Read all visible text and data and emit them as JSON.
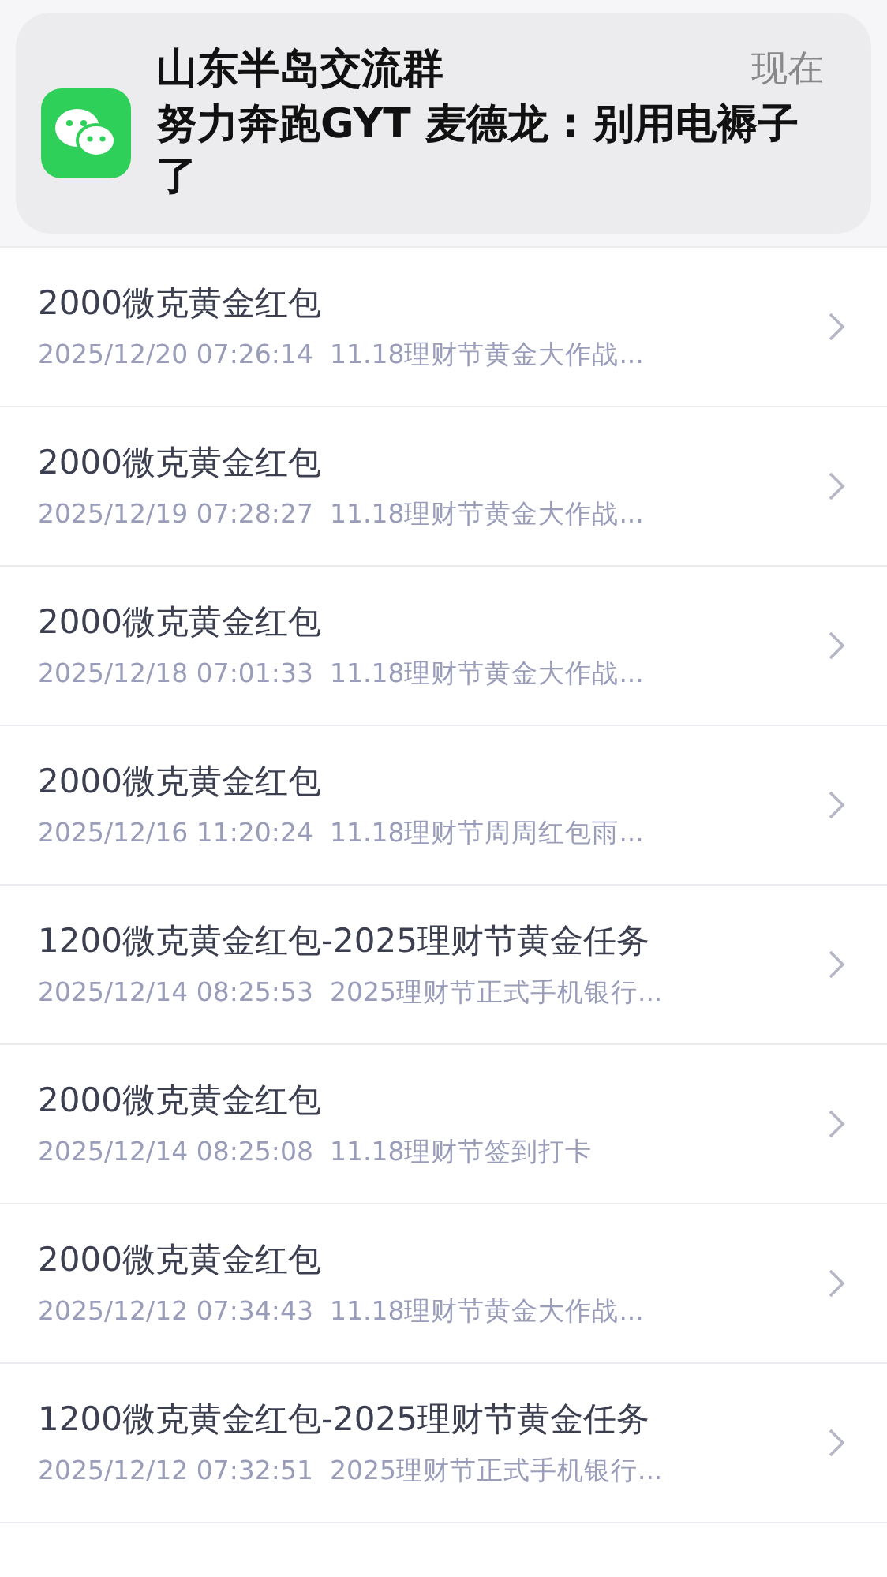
{
  "notification": {
    "group": "山东半岛交流群",
    "time": "现在",
    "message": "努力奔跑GYT 麦德龙 : 别用电褥子了"
  },
  "records": [
    {
      "title": "2000微克黄金红包",
      "time": "2025/12/20 07:26:14",
      "note": "11.18理财节黄金大作战..."
    },
    {
      "title": "2000微克黄金红包",
      "time": "2025/12/19 07:28:27",
      "note": "11.18理财节黄金大作战..."
    },
    {
      "title": "2000微克黄金红包",
      "time": "2025/12/18 07:01:33",
      "note": "11.18理财节黄金大作战..."
    },
    {
      "title": "2000微克黄金红包",
      "time": "2025/12/16 11:20:24",
      "note": "11.18理财节周周红包雨..."
    },
    {
      "title": "1200微克黄金红包-2025理财节黄金任务",
      "time": "2025/12/14 08:25:53",
      "note": "2025理财节正式手机银行..."
    },
    {
      "title": "2000微克黄金红包",
      "time": "2025/12/14 08:25:08",
      "note": "11.18理财节签到打卡"
    },
    {
      "title": "2000微克黄金红包",
      "time": "2025/12/12 07:34:43",
      "note": "11.18理财节黄金大作战..."
    },
    {
      "title": "1200微克黄金红包-2025理财节黄金任务",
      "time": "2025/12/12 07:32:51",
      "note": "2025理财节正式手机银行..."
    }
  ]
}
